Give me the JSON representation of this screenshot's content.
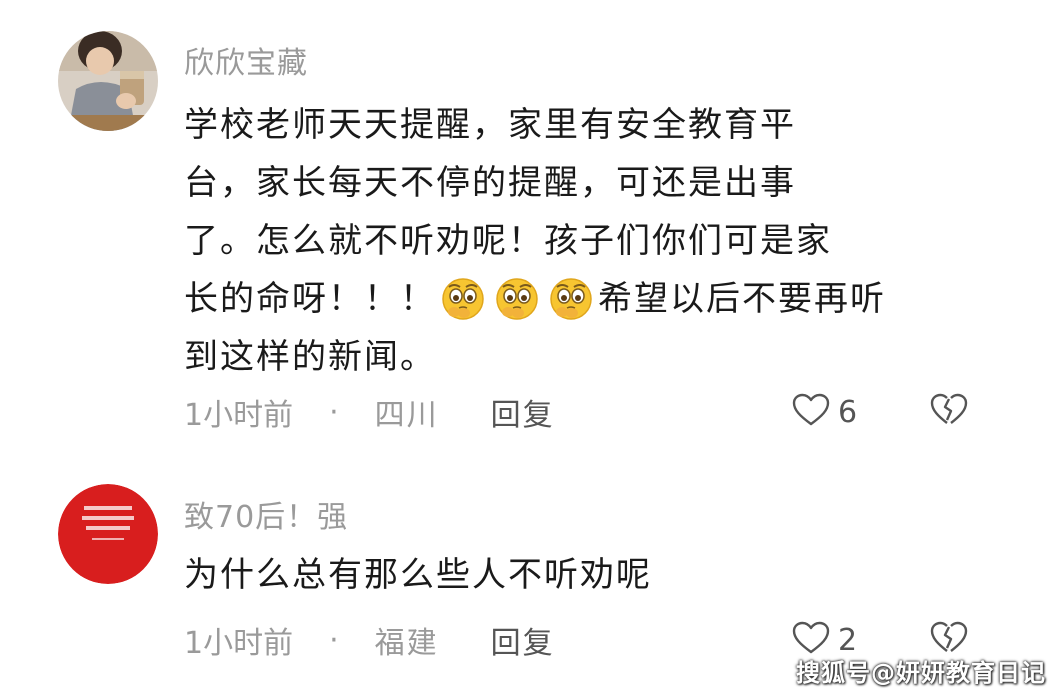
{
  "comments": [
    {
      "username": "欣欣宝藏",
      "text_lines": [
        "学校老师天天提醒，家里有安全教育平",
        "台，家长每天不停的提醒，可还是出事",
        "了。怎么就不听劝呢！孩子们你们可是家",
        "长的命呀！！！",
        "希望以后不要再听",
        "到这样的新闻。"
      ],
      "emoji_icon": "worried-pleading-face-icon",
      "emoji_count": 3,
      "time": "1小时前",
      "separator": "·",
      "location": "四川",
      "reply_label": "回复",
      "like_count": "6"
    },
    {
      "username": "致70后！强",
      "text_lines": [
        "为什么总有那么些人不听劝呢"
      ],
      "time": "1小时前",
      "separator": "·",
      "location": "福建",
      "reply_label": "回复",
      "like_count": "2"
    }
  ],
  "icons": {
    "like": "heart-outline-icon",
    "dislike": "broken-heart-icon"
  },
  "colors": {
    "username": "#9a9a9a",
    "text": "#1a1a1a",
    "meta": "#9a9a9a",
    "avatar2_bg": "#d81e1e",
    "emoji_yellow": "#f7c531"
  },
  "watermark": "搜狐号@妍妍教育日记"
}
